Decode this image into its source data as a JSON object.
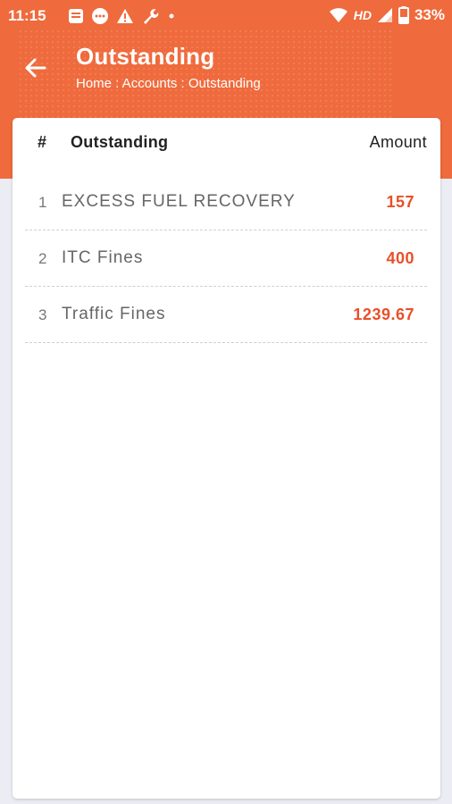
{
  "status_bar": {
    "time": "11:15",
    "network_label": "HD",
    "battery": "33%",
    "notification_icons": [
      "message-icon",
      "chat-bubble-icon",
      "warning-icon",
      "wrench-icon",
      "dot-icon"
    ],
    "status_icons": [
      "wifi-icon",
      "signal-icon",
      "battery-icon"
    ]
  },
  "header": {
    "title": "Outstanding",
    "breadcrumb": "Home : Accounts : Outstanding",
    "back_icon": "arrow-left-icon",
    "color": "#ef6a3c"
  },
  "table": {
    "columns": {
      "index": "#",
      "name": "Outstanding",
      "amount": "Amount"
    },
    "rows": [
      {
        "index": "1",
        "name": "EXCESS FUEL RECOVERY",
        "amount": "157"
      },
      {
        "index": "2",
        "name": "ITC Fines",
        "amount": "400"
      },
      {
        "index": "3",
        "name": "Traffic Fines",
        "amount": "1239.67"
      }
    ],
    "amount_color": "#e8502a"
  }
}
